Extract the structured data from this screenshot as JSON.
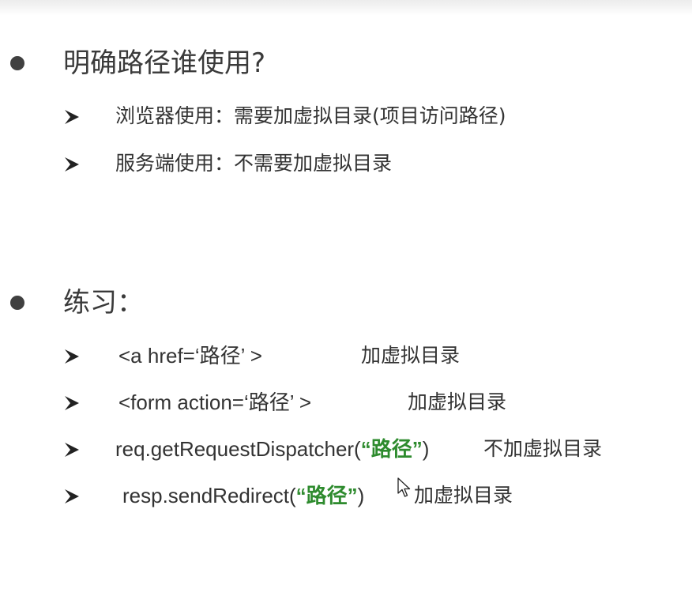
{
  "section1": {
    "title": "明确路径谁使用?",
    "items": [
      {
        "text": "浏览器使用：需要加虚拟目录(项目访问路径)"
      },
      {
        "text": "服务端使用：不需要加虚拟目录"
      }
    ]
  },
  "section2": {
    "title": "练习：",
    "items": [
      {
        "code_prefix": "<a href=",
        "quote_open": "‘",
        "path": "路径",
        "quote_close": "’",
        "code_suffix": " >",
        "note": "加虚拟目录"
      },
      {
        "code_prefix": "<form action=",
        "quote_open": "‘",
        "path": "路径",
        "quote_close": "’",
        "code_suffix": " >",
        "note": "加虚拟目录"
      },
      {
        "code_prefix": "req.getRequestDispatcher(",
        "quote_open": "“",
        "path": "路径",
        "quote_close": "”",
        "code_suffix": ")",
        "note": "不加虚拟目录"
      },
      {
        "code_prefix": "resp.sendRedirect(",
        "quote_open": "“",
        "path": "路径",
        "quote_close": "”",
        "code_suffix": ")",
        "note": "加虚拟目录"
      }
    ]
  },
  "icons": {
    "bullet": "filled-circle-bullet",
    "sub_bullet": "arrowhead-bullet",
    "cursor": "mouse-pointer"
  },
  "colors": {
    "path_highlight": "#2e8b2e",
    "text": "#333333",
    "bullet": "#404040"
  }
}
